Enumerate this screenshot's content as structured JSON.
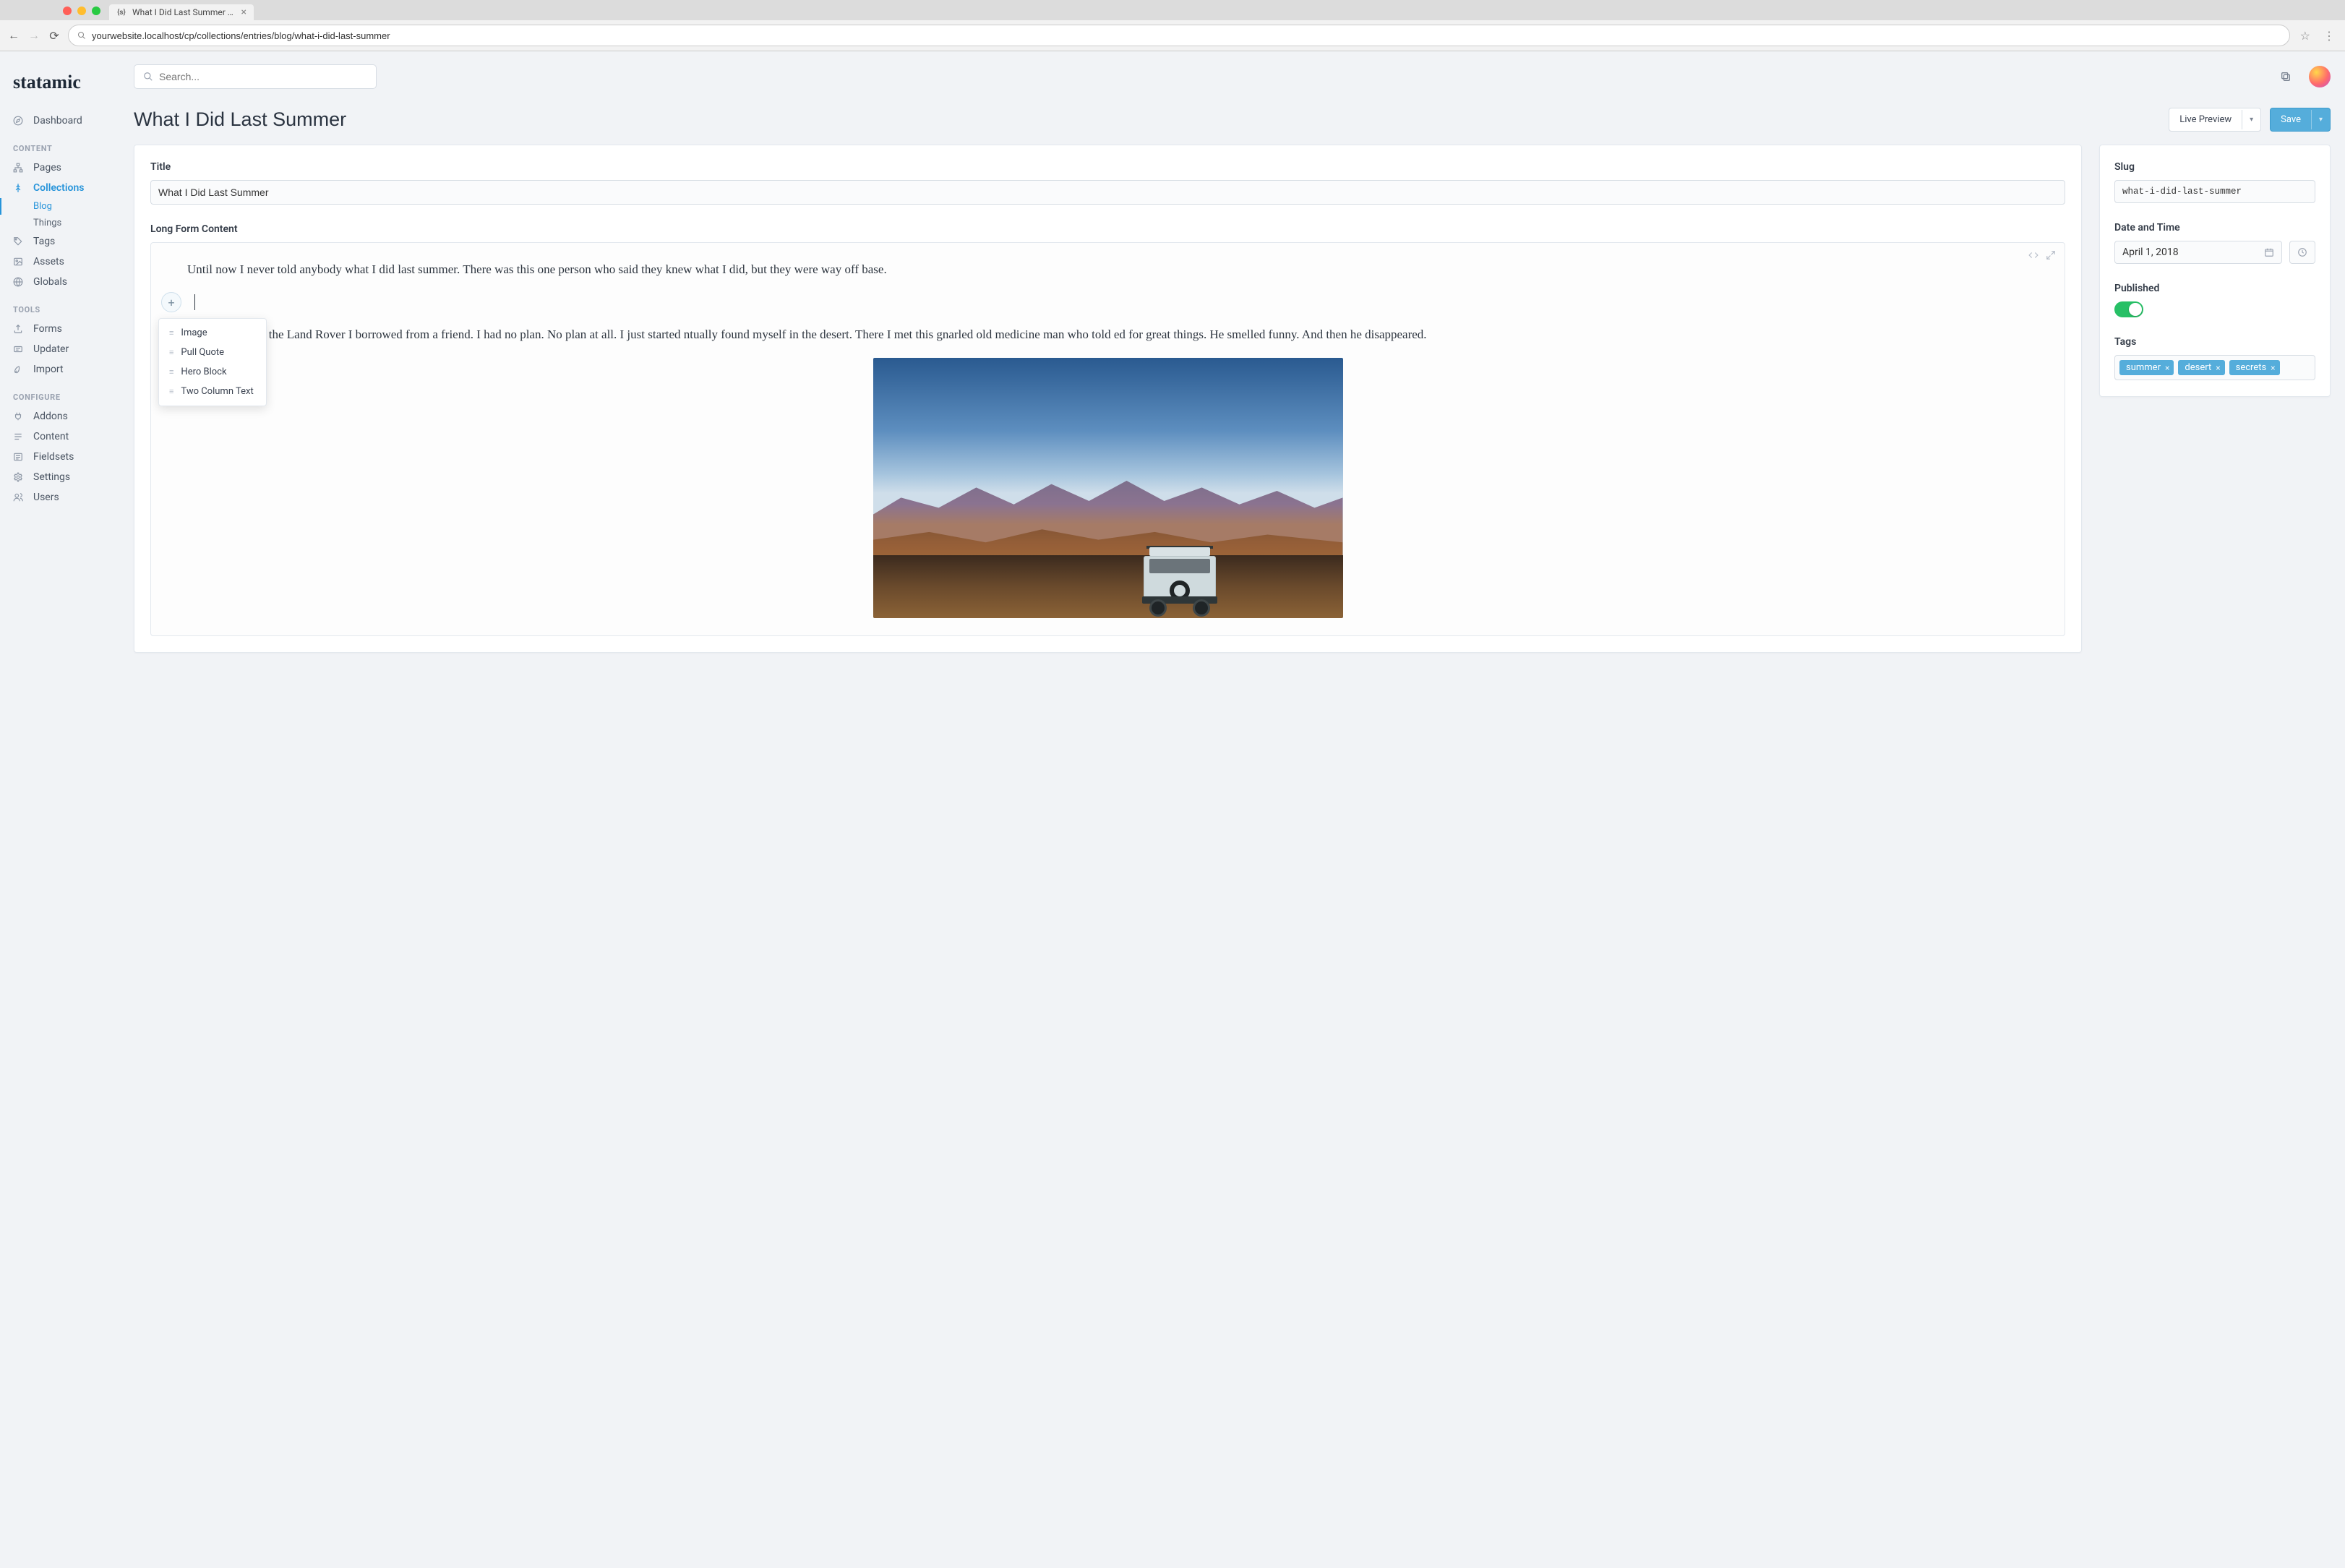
{
  "browser": {
    "tab_title": "What I Did Last Summer | Stat…",
    "url": "yourwebsite.localhost/cp/collections/entries/blog/what-i-did-last-summer"
  },
  "brand": "statamic",
  "search": {
    "placeholder": "Search..."
  },
  "sidebar": {
    "dashboard": "Dashboard",
    "headings": {
      "content": "CONTENT",
      "tools": "TOOLS",
      "configure": "CONFIGURE"
    },
    "content": [
      {
        "label": "Pages"
      },
      {
        "label": "Collections",
        "active": true,
        "children": [
          {
            "label": "Blog",
            "active": true
          },
          {
            "label": "Things"
          }
        ]
      },
      {
        "label": "Tags"
      },
      {
        "label": "Assets"
      },
      {
        "label": "Globals"
      }
    ],
    "tools": [
      {
        "label": "Forms"
      },
      {
        "label": "Updater"
      },
      {
        "label": "Import"
      }
    ],
    "configure": [
      {
        "label": "Addons"
      },
      {
        "label": "Content"
      },
      {
        "label": "Fieldsets"
      },
      {
        "label": "Settings"
      },
      {
        "label": "Users"
      }
    ]
  },
  "header": {
    "title": "What I Did Last Summer",
    "live_preview": "Live Preview",
    "save": "Save"
  },
  "fields": {
    "title_label": "Title",
    "title_value": "What I Did Last Summer",
    "content_label": "Long Form Content",
    "para1": "Until now I never told anybody what I did last summer. There was this one person who said they knew what I did, but they were way off base.",
    "para2_partial": "n the Land Rover I borrowed from a friend. I had no plan. No plan at all. I just started ntually found myself in the desert. There I met this gnarled old medicine man who told ed for great things. He smelled funny. And then he disappeared."
  },
  "block_menu": {
    "items": [
      "Image",
      "Pull Quote",
      "Hero Block",
      "Two Column Text"
    ]
  },
  "meta": {
    "slug_label": "Slug",
    "slug_value": "what-i-did-last-summer",
    "date_label": "Date and Time",
    "date_value": "April 1, 2018",
    "published_label": "Published",
    "published": true,
    "tags_label": "Tags",
    "tags": [
      "summer",
      "desert",
      "secrets"
    ]
  }
}
